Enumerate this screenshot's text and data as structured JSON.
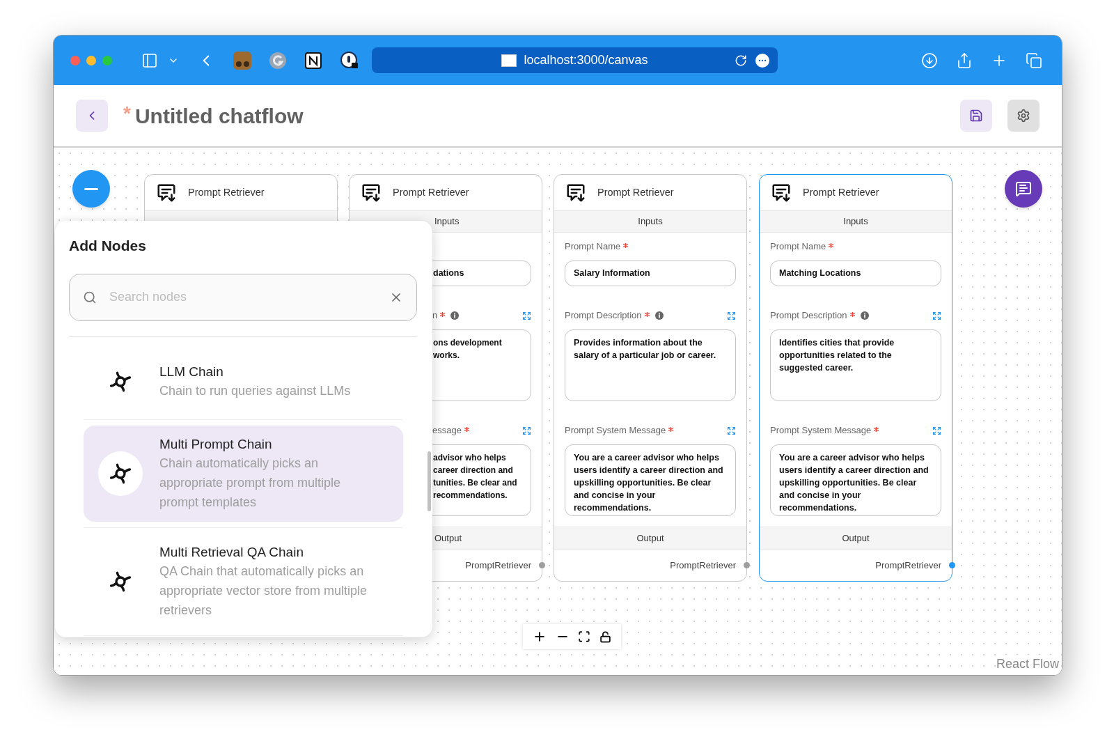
{
  "browser": {
    "url": "localhost:3000/canvas"
  },
  "header": {
    "unsaved_mark": "*",
    "title": "Untitled chatflow"
  },
  "nodes": [
    {
      "title": "Prompt Retriever",
      "selected": false
    },
    {
      "title": "Prompt Retriever",
      "selected": false,
      "inputs_label": "Inputs",
      "fields": [
        {
          "kind": "line",
          "value": "dations"
        },
        {
          "kind": "area",
          "label": "n",
          "required": true,
          "info": true,
          "expandable": true,
          "value": "ons development\nworks."
        },
        {
          "kind": "area",
          "label": "essage",
          "required": true,
          "info": false,
          "expandable": true,
          "value": "advisor who helps\ncareer direction and\ntunities. Be clear and\nrecommendations."
        }
      ],
      "output_label": "Output",
      "output_name": "PromptRetriever"
    },
    {
      "title": "Prompt Retriever",
      "selected": false,
      "inputs_label": "Inputs",
      "fields": [
        {
          "kind": "line",
          "label": "Prompt Name",
          "required": true,
          "info": false,
          "expandable": false,
          "value": "Salary Information"
        },
        {
          "kind": "area",
          "label": "Prompt Description",
          "required": true,
          "info": true,
          "expandable": true,
          "value": "Provides information about the salary of a particular job or career."
        },
        {
          "kind": "area",
          "label": "Prompt System Message",
          "required": true,
          "info": false,
          "expandable": true,
          "value": "You are a career advisor who helps users identify a career direction and upskilling opportunities. Be clear and concise in your recommendations."
        }
      ],
      "output_label": "Output",
      "output_name": "PromptRetriever"
    },
    {
      "title": "Prompt Retriever",
      "selected": true,
      "inputs_label": "Inputs",
      "fields": [
        {
          "kind": "line",
          "label": "Prompt Name",
          "required": true,
          "info": false,
          "expandable": false,
          "value": "Matching Locations"
        },
        {
          "kind": "area",
          "label": "Prompt Description",
          "required": true,
          "info": true,
          "expandable": true,
          "value": "Identifies cities that provide opportunities related to the suggested career."
        },
        {
          "kind": "area",
          "label": "Prompt System Message",
          "required": true,
          "info": false,
          "expandable": true,
          "value": "You are a career advisor who helps users identify a career direction and upskilling opportunities. Be clear and concise in your recommendations."
        }
      ],
      "output_label": "Output",
      "output_name": "PromptRetriever"
    }
  ],
  "add_nodes": {
    "title": "Add Nodes",
    "search": {
      "placeholder": "Search nodes"
    },
    "items": [
      {
        "name": "LLM Chain",
        "description": "Chain to run queries against LLMs",
        "selected": false
      },
      {
        "name": "Multi Prompt Chain",
        "description": "Chain automatically picks an appropriate prompt from multiple prompt templates",
        "selected": true
      },
      {
        "name": "Multi Retrieval QA Chain",
        "description": "QA Chain that automatically picks an appropriate vector store from multiple retrievers",
        "selected": false
      }
    ]
  },
  "attribution": "React Flow"
}
